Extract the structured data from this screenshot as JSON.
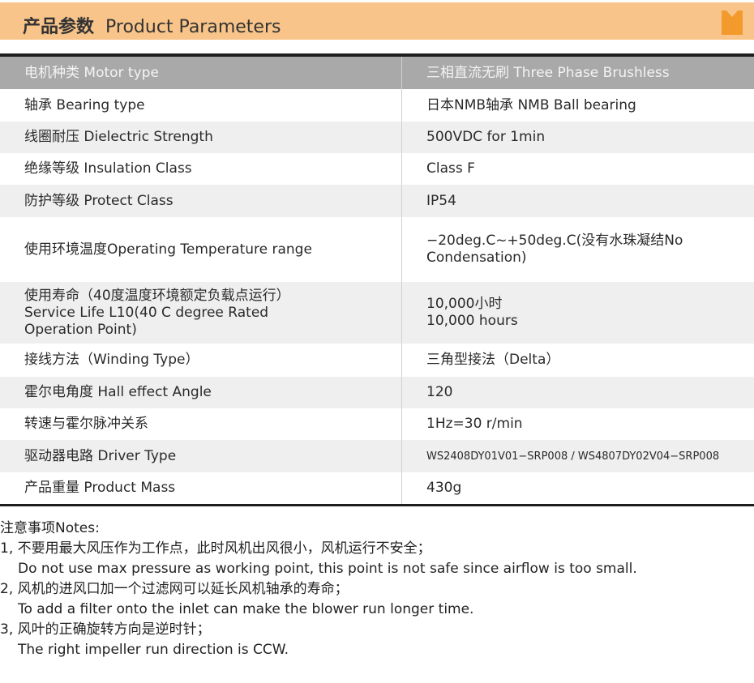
{
  "header": {
    "title_zh": "产品参数",
    "title_en": "Product Parameters"
  },
  "table": {
    "rows": [
      {
        "label": "电机种类 Motor type",
        "value": "三相直流无刷 Three Phase Brushless"
      },
      {
        "label": "轴承 Bearing type",
        "value": "日本NMB轴承 NMB Ball bearing"
      },
      {
        "label": "线圈耐压 Dielectric Strength",
        "value": "500VDC for 1min"
      },
      {
        "label": "绝缘等级 Insulation Class",
        "value": "Class F"
      },
      {
        "label": "防护等级 Protect Class",
        "value": "IP54"
      },
      {
        "label": "使用环境温度Operating Temperature range",
        "value": "−20deg.C~+50deg.C(没有水珠凝结No Condensation)"
      },
      {
        "label": "使用寿命（40度温度环境额定负载点运行）",
        "label2": "Service Life L10(40 C degree Rated Operation Point)",
        "value": "10,000小时",
        "value2": "10,000 hours"
      },
      {
        "label": "接线方法（Winding Type）",
        "value": "三角型接法（Delta）"
      },
      {
        "label": "霍尔电角度  Hall effect Angle",
        "value": "120"
      },
      {
        "label": "转速与霍尔脉冲关系",
        "value": "1Hz=30 r/min"
      },
      {
        "label": "驱动器电路 Driver Type",
        "value": "WS2408DY01V01−SRP008  /  WS4807DY02V04−SRP008"
      },
      {
        "label": "产品重量 Product Mass",
        "value": "430g"
      }
    ]
  },
  "notes": {
    "title": "注意事项Notes:",
    "items": [
      {
        "zh": "1, 不要用最大风压作为工作点，此时风机出风很小，风机运行不安全；",
        "en": "Do not use max pressure as working point, this point is not safe since airflow is  too small."
      },
      {
        "zh": "2, 风机的进风口加一个过滤网可以延长风机轴承的寿命；",
        "en": "To add a filter onto the inlet can make the blower run longer time."
      },
      {
        "zh": "3, 风叶的正确旋转方向是逆时针；",
        "en": "The right impeller run direction is CCW."
      }
    ]
  },
  "colors": {
    "header_bar": "#f8c48a",
    "header_icon": "#f39a2c",
    "table_head": "#a9a9a9",
    "row_alt": "#efefef"
  }
}
